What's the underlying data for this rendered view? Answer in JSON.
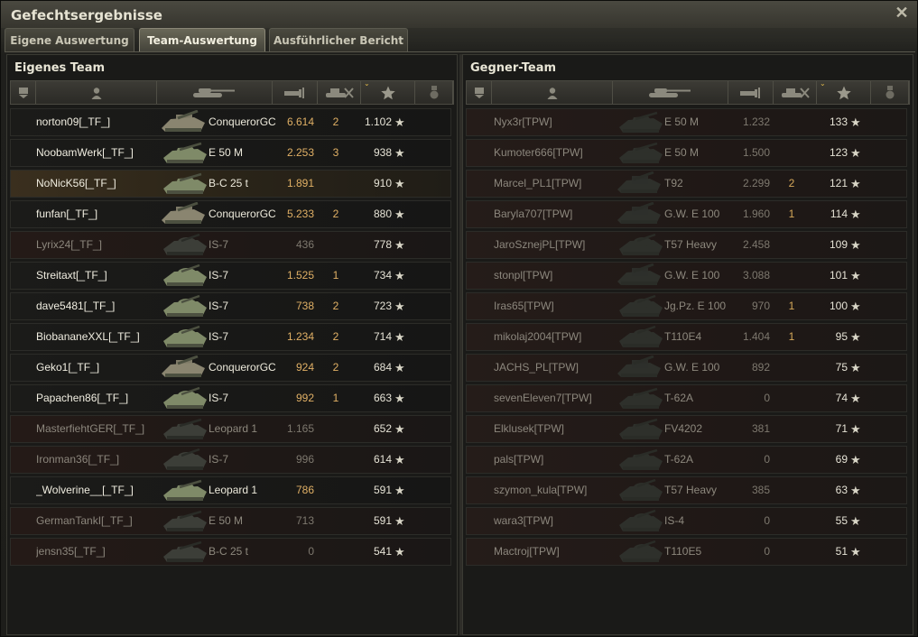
{
  "window": {
    "title": "Gefechtsergebnisse",
    "close_icon": "close-icon"
  },
  "tabs": [
    {
      "label": "Eigene Auswertung",
      "active": false
    },
    {
      "label": "Team-Auswertung",
      "active": true
    },
    {
      "label": "Ausführlicher Bericht",
      "active": false
    }
  ],
  "own_team": {
    "title": "Eigenes Team",
    "rows": [
      {
        "name": "norton09[_TF_]",
        "vehicle": "ConquerorGC",
        "damage": "6.614",
        "kills": "2",
        "exp": "1.102",
        "state": "alive",
        "tank": "spg"
      },
      {
        "name": "NoobamWerk[_TF_]",
        "vehicle": "E 50 M",
        "damage": "2.253",
        "kills": "3",
        "exp": "938",
        "state": "alive",
        "tank": "med"
      },
      {
        "name": "NoNicK56[_TF_]",
        "vehicle": "B-C 25 t",
        "damage": "1.891",
        "kills": "",
        "exp": "910",
        "state": "self",
        "tank": "med"
      },
      {
        "name": "funfan[_TF_]",
        "vehicle": "ConquerorGC",
        "damage": "5.233",
        "kills": "2",
        "exp": "880",
        "state": "alive",
        "tank": "spg"
      },
      {
        "name": "Lyrix24[_TF_]",
        "vehicle": "IS-7",
        "damage": "436",
        "kills": "",
        "exp": "778",
        "state": "dead",
        "tank": "heavy"
      },
      {
        "name": "Streitaxt[_TF_]",
        "vehicle": "IS-7",
        "damage": "1.525",
        "kills": "1",
        "exp": "734",
        "state": "alive",
        "tank": "heavy"
      },
      {
        "name": "dave5481[_TF_]",
        "vehicle": "IS-7",
        "damage": "738",
        "kills": "2",
        "exp": "723",
        "state": "alive",
        "tank": "heavy"
      },
      {
        "name": "BiobananeXXL[_TF_]",
        "vehicle": "IS-7",
        "damage": "1.234",
        "kills": "2",
        "exp": "714",
        "state": "alive",
        "tank": "heavy"
      },
      {
        "name": "Geko1[_TF_]",
        "vehicle": "ConquerorGC",
        "damage": "924",
        "kills": "2",
        "exp": "684",
        "state": "alive",
        "tank": "spg"
      },
      {
        "name": "Papachen86[_TF_]",
        "vehicle": "IS-7",
        "damage": "992",
        "kills": "1",
        "exp": "663",
        "state": "alive",
        "tank": "heavy"
      },
      {
        "name": "MasterfiehtGER[_TF_]",
        "vehicle": "Leopard 1",
        "damage": "1.165",
        "kills": "",
        "exp": "652",
        "state": "dead",
        "tank": "med"
      },
      {
        "name": "Ironman36[_TF_]",
        "vehicle": "IS-7",
        "damage": "996",
        "kills": "",
        "exp": "614",
        "state": "dead",
        "tank": "heavy"
      },
      {
        "name": "_Wolverine__[_TF_]",
        "vehicle": "Leopard 1",
        "damage": "786",
        "kills": "",
        "exp": "591",
        "state": "alive",
        "tank": "med"
      },
      {
        "name": "GermanTankI[_TF_]",
        "vehicle": "E 50 M",
        "damage": "713",
        "kills": "",
        "exp": "591",
        "state": "dead",
        "tank": "med"
      },
      {
        "name": "jensn35[_TF_]",
        "vehicle": "B-C 25 t",
        "damage": "0",
        "kills": "",
        "exp": "541",
        "state": "dead",
        "tank": "med"
      }
    ]
  },
  "enemy_team": {
    "title": "Gegner-Team",
    "rows": [
      {
        "name": "Nyx3r[TPW]",
        "vehicle": "E 50 M",
        "damage": "1.232",
        "kills": "",
        "exp": "133",
        "tank": "med"
      },
      {
        "name": "Kumoter666[TPW]",
        "vehicle": "E 50 M",
        "damage": "1.500",
        "kills": "",
        "exp": "123",
        "tank": "med"
      },
      {
        "name": "Marcel_PL1[TPW]",
        "vehicle": "T92",
        "damage": "2.299",
        "kills": "2",
        "exp": "121",
        "tank": "spg"
      },
      {
        "name": "Baryla707[TPW]",
        "vehicle": "G.W. E 100",
        "damage": "1.960",
        "kills": "1",
        "exp": "114",
        "tank": "spg"
      },
      {
        "name": "JaroSznejPL[TPW]",
        "vehicle": "T57 Heavy",
        "damage": "2.458",
        "kills": "",
        "exp": "109",
        "tank": "heavy"
      },
      {
        "name": "stonpl[TPW]",
        "vehicle": "G.W. E 100",
        "damage": "3.088",
        "kills": "",
        "exp": "101",
        "tank": "spg"
      },
      {
        "name": "Iras65[TPW]",
        "vehicle": "Jg.Pz. E 100",
        "damage": "970",
        "kills": "1",
        "exp": "100",
        "tank": "heavy"
      },
      {
        "name": "mikolaj2004[TPW]",
        "vehicle": "T110E4",
        "damage": "1.404",
        "kills": "1",
        "exp": "95",
        "tank": "heavy"
      },
      {
        "name": "JACHS_PL[TPW]",
        "vehicle": "G.W. E 100",
        "damage": "892",
        "kills": "",
        "exp": "75",
        "tank": "spg"
      },
      {
        "name": "sevenEleven7[TPW]",
        "vehicle": "T-62A",
        "damage": "0",
        "kills": "",
        "exp": "74",
        "tank": "med"
      },
      {
        "name": "Elklusek[TPW]",
        "vehicle": "FV4202",
        "damage": "381",
        "kills": "",
        "exp": "71",
        "tank": "med"
      },
      {
        "name": "pals[TPW]",
        "vehicle": "T-62A",
        "damage": "0",
        "kills": "",
        "exp": "69",
        "tank": "med"
      },
      {
        "name": "szymon_kula[TPW]",
        "vehicle": "T57 Heavy",
        "damage": "385",
        "kills": "",
        "exp": "63",
        "tank": "heavy"
      },
      {
        "name": "wara3[TPW]",
        "vehicle": "IS-4",
        "damage": "0",
        "kills": "",
        "exp": "55",
        "tank": "heavy"
      },
      {
        "name": "Mactroj[TPW]",
        "vehicle": "T110E5",
        "damage": "0",
        "kills": "",
        "exp": "51",
        "tank": "heavy"
      }
    ]
  },
  "columns": {
    "icons": [
      "squad-icon",
      "player-icon",
      "tank-icon",
      "damage-icon",
      "kills-icon",
      "experience-icon",
      "medal-icon"
    ],
    "sort_indicator": "chevron-down-icon"
  },
  "colors": {
    "damage": "#e0b065",
    "self_row": "#3a2f1e",
    "dead_row": "#241a17"
  },
  "star_glyph": "★"
}
